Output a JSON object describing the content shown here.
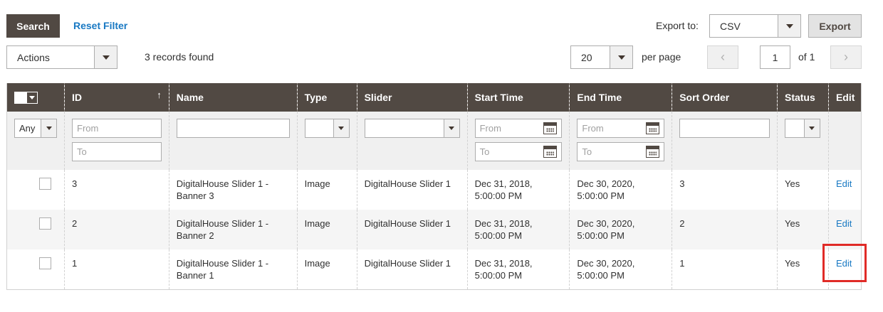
{
  "toolbar": {
    "search_label": "Search",
    "reset_label": "Reset Filter",
    "export_label": "Export to:",
    "export_format": "CSV",
    "export_button": "Export",
    "actions_value": "Actions",
    "records_found": "3 records found",
    "per_page_value": "20",
    "per_page_label": "per page",
    "prev_icon": "‹",
    "next_icon": "›",
    "page_current": "1",
    "page_total_label": "of 1"
  },
  "columns": [
    {
      "label": ""
    },
    {
      "label": "ID",
      "sort_icon": "↑"
    },
    {
      "label": "Name"
    },
    {
      "label": "Type"
    },
    {
      "label": "Slider"
    },
    {
      "label": "Start Time"
    },
    {
      "label": "End Time"
    },
    {
      "label": "Sort Order"
    },
    {
      "label": "Status"
    },
    {
      "label": "Edit"
    }
  ],
  "filters": {
    "select_any": "Any",
    "from_placeholder": "From",
    "to_placeholder": "To"
  },
  "rows": [
    {
      "id": "3",
      "name": "DigitalHouse Slider 1 - Banner 3",
      "type": "Image",
      "slider": "DigitalHouse Slider 1",
      "start": "Dec 31, 2018, 5:00:00 PM",
      "end": "Dec 30, 2020, 5:00:00 PM",
      "sort": "3",
      "status": "Yes",
      "edit": "Edit"
    },
    {
      "id": "2",
      "name": "DigitalHouse Slider 1 - Banner 2",
      "type": "Image",
      "slider": "DigitalHouse Slider 1",
      "start": "Dec 31, 2018, 5:00:00 PM",
      "end": "Dec 30, 2020, 5:00:00 PM",
      "sort": "2",
      "status": "Yes",
      "edit": "Edit"
    },
    {
      "id": "1",
      "name": "DigitalHouse Slider 1 - Banner 1",
      "type": "Image",
      "slider": "DigitalHouse Slider 1",
      "start": "Dec 31, 2018, 5:00:00 PM",
      "end": "Dec 30, 2020, 5:00:00 PM",
      "sort": "1",
      "status": "Yes",
      "edit": "Edit"
    }
  ],
  "colors": {
    "header_bg": "#514943",
    "link": "#1979c3",
    "highlight": "#e02b27"
  }
}
